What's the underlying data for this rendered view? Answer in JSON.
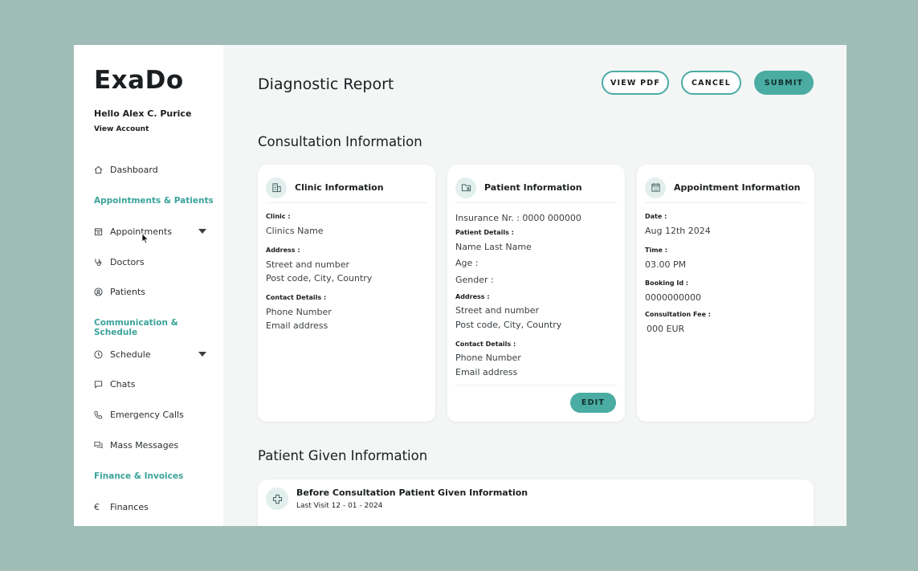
{
  "app": {
    "logo": "ExaDo",
    "greeting": "Hello Alex C. Purice",
    "view_account": "View Account"
  },
  "sidebar": {
    "dashboard": "Dashboard",
    "section_appointments": "Appointments & Patients",
    "appointments": "Appointments",
    "doctors": "Doctors",
    "patients": "Patients",
    "section_communication": "Communication & Schedule",
    "schedule": "Schedule",
    "chats": "Chats",
    "emergency_calls": "Emergency Calls",
    "mass_messages": "Mass Messages",
    "section_finance": "Finance & Invoices",
    "finances": "Finances"
  },
  "header": {
    "title": "Diagnostic Report",
    "view_pdf": "VIEW PDF",
    "cancel": "CANCEL",
    "submit": "SUBMIT"
  },
  "consultation": {
    "title": "Consultation Information",
    "clinic": {
      "title": "Clinic Information",
      "clinic_label": "Clinic :",
      "clinic_name": "Clinics Name",
      "address_label": "Address :",
      "street": "Street and number",
      "city": "Post code, City, Country",
      "contact_label": "Contact Details :",
      "phone": "Phone Number",
      "email": "Email address"
    },
    "patient": {
      "title": "Patient Information",
      "insurance": "Insurance Nr. : 0000 000000",
      "details_label": "Patient Details :",
      "name": "Name Last Name",
      "age": "Age :",
      "gender": "Gender :",
      "address_label": "Address :",
      "street": "Street and number",
      "city": "Post code, City, Country",
      "contact_label": "Contact Details :",
      "phone": "Phone Number",
      "email": "Email address",
      "edit": "EDIT"
    },
    "appointment": {
      "title": "Appointment Information",
      "date_label": "Date :",
      "date": "Aug 12th 2024",
      "time_label": "Time :",
      "time": "03.00 PM",
      "booking_label": "Booking Id :",
      "booking_id": "0000000000",
      "fee_label": "Consultation Fee :",
      "fee": "000 EUR"
    }
  },
  "patient_given": {
    "title": "Patient Given Information",
    "card_title": "Before Consultation Patient Given Information",
    "last_visit": "Last Visit 12 - 01 - 2024"
  },
  "colors": {
    "accent": "#4aaca3",
    "section": "#3aa39a",
    "backdrop": "#9fbcb7"
  }
}
